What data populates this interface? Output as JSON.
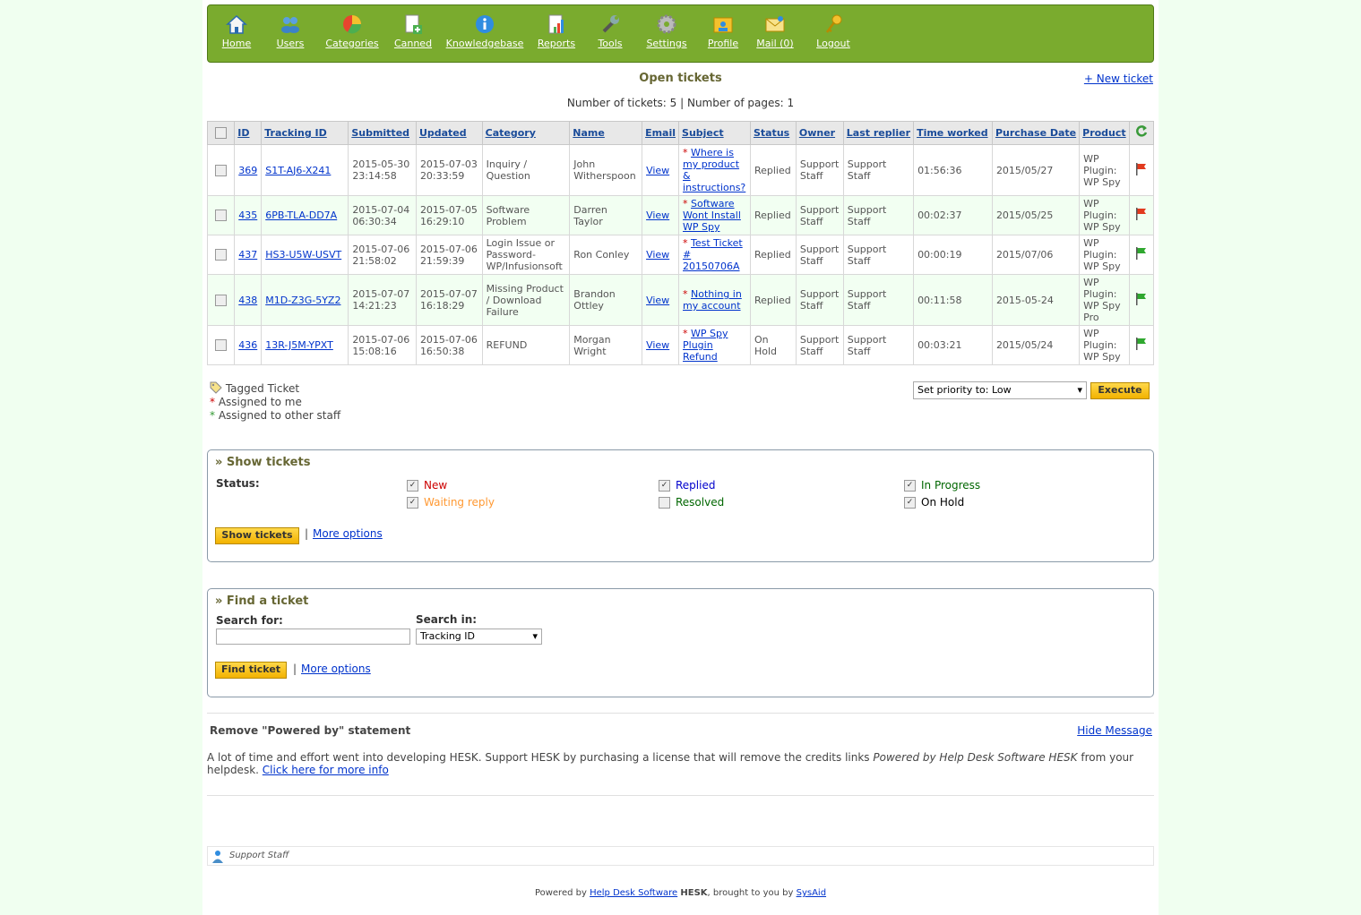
{
  "nav": {
    "items": [
      {
        "label": "Home",
        "icon": "home-icon"
      },
      {
        "label": "Users",
        "icon": "users-icon"
      },
      {
        "label": "Categories",
        "icon": "categories-icon"
      },
      {
        "label": "Canned",
        "icon": "canned-icon"
      },
      {
        "label": "Knowledgebase",
        "icon": "knowledgebase-icon"
      },
      {
        "label": "Reports",
        "icon": "reports-icon"
      },
      {
        "label": "Tools",
        "icon": "tools-icon"
      },
      {
        "label": "Settings",
        "icon": "settings-icon"
      },
      {
        "label": "Profile",
        "icon": "profile-icon"
      },
      {
        "label": "Mail (0)",
        "icon": "mail-icon"
      },
      {
        "label": "Logout",
        "icon": "logout-icon"
      }
    ]
  },
  "header": {
    "title": "Open tickets",
    "new_ticket": "+ New ticket",
    "counts": "Number of tickets: 5 | Number of pages: 1"
  },
  "table": {
    "columns": [
      "ID",
      "Tracking ID",
      "Submitted",
      "Updated",
      "Category",
      "Name",
      "Email",
      "Subject",
      "Status",
      "Owner",
      "Last replier",
      "Time worked",
      "Purchase Date",
      "Product"
    ],
    "rows": [
      {
        "id": "369",
        "tracking": "S1T-AJ6-X241",
        "submitted": "2015-05-30 23:14:58",
        "updated": "2015-07-03 20:33:59",
        "category": "Inquiry / Question",
        "name": "John Witherspoon",
        "email": "View",
        "subject": "Where is my product & instructions?",
        "status": "Replied",
        "owner": "Support Staff",
        "replier": "Support Staff",
        "time": "01:56:36",
        "purchase": "2015/05/27",
        "product": "WP Plugin: WP Spy",
        "flag": "red"
      },
      {
        "id": "435",
        "tracking": "6PB-TLA-DD7A",
        "submitted": "2015-07-04 06:30:34",
        "updated": "2015-07-05 16:29:10",
        "category": "Software Problem",
        "name": "Darren Taylor",
        "email": "View",
        "subject": "Software Wont Install WP Spy",
        "status": "Replied",
        "owner": "Support Staff",
        "replier": "Support Staff",
        "time": "00:02:37",
        "purchase": "2015/05/25",
        "product": "WP Plugin: WP Spy",
        "flag": "red"
      },
      {
        "id": "437",
        "tracking": "HS3-U5W-USVT",
        "submitted": "2015-07-06 21:58:02",
        "updated": "2015-07-06 21:59:39",
        "category": "Login Issue or Password-WP/Infusionsoft",
        "name": "Ron Conley",
        "email": "View",
        "subject": "Test Ticket # 20150706A",
        "status": "Replied",
        "owner": "Support Staff",
        "replier": "Support Staff",
        "time": "00:00:19",
        "purchase": "2015/07/06",
        "product": "WP Plugin: WP Spy",
        "flag": "green"
      },
      {
        "id": "438",
        "tracking": "M1D-Z3G-5YZ2",
        "submitted": "2015-07-07 14:21:23",
        "updated": "2015-07-07 16:18:29",
        "category": "Missing Product / Download Failure",
        "name": "Brandon Ottley",
        "email": "View",
        "subject": "Nothing in my account",
        "status": "Replied",
        "owner": "Support Staff",
        "replier": "Support Staff",
        "time": "00:11:58",
        "purchase": "2015-05-24",
        "product": "WP Plugin: WP Spy Pro",
        "flag": "green"
      },
      {
        "id": "436",
        "tracking": "13R-J5M-YPXT",
        "submitted": "2015-07-06 15:08:16",
        "updated": "2015-07-06 16:50:38",
        "category": "REFUND",
        "name": "Morgan Wright",
        "email": "View",
        "subject": "WP Spy Plugin Refund",
        "status": "On Hold",
        "owner": "Support Staff",
        "replier": "Support Staff",
        "time": "00:03:21",
        "purchase": "2015/05/24",
        "product": "WP Plugin: WP Spy",
        "flag": "green"
      }
    ]
  },
  "legend": {
    "tagged": "Tagged Ticket",
    "assigned_me": "Assigned to me",
    "assigned_other": "Assigned to other staff"
  },
  "bulk": {
    "priority_value": "Set priority to: Low",
    "execute": "Execute"
  },
  "show_tickets": {
    "title": "» Show tickets",
    "status_label": "Status:",
    "statuses": [
      {
        "label": "New",
        "checked": true,
        "color": "#cc0000"
      },
      {
        "label": "Replied",
        "checked": true,
        "color": "#0000cc"
      },
      {
        "label": "In Progress",
        "checked": true,
        "color": "#006600"
      },
      {
        "label": "Waiting reply",
        "checked": true,
        "color": "#ff9933"
      },
      {
        "label": "Resolved",
        "checked": false,
        "color": "#006600"
      },
      {
        "label": "On Hold",
        "checked": true,
        "color": "#000000"
      }
    ],
    "button": "Show tickets",
    "sep": "|",
    "more": "More options"
  },
  "find_ticket": {
    "title": "» Find a ticket",
    "search_for": "Search for:",
    "search_in": "Search in:",
    "search_value": "",
    "search_in_value": "Tracking ID",
    "button": "Find ticket",
    "sep": "|",
    "more": "More options"
  },
  "powered_notice": {
    "title": "Remove \"Powered by\" statement",
    "hide": "Hide Message",
    "text1": "A lot of time and effort went into developing HESK. Support HESK by purchasing a license that will remove the credits links",
    "italic": "Powered by Help Desk Software HESK",
    "text2": "from your helpdesk.",
    "link": "Click here for more info"
  },
  "footer": {
    "user": "Support Staff",
    "powered_prefix": "Powered by",
    "powered_link": "Help Desk Software",
    "powered_brand": "HESK",
    "brought": ", brought to you by",
    "sysaid": "SysAid"
  }
}
